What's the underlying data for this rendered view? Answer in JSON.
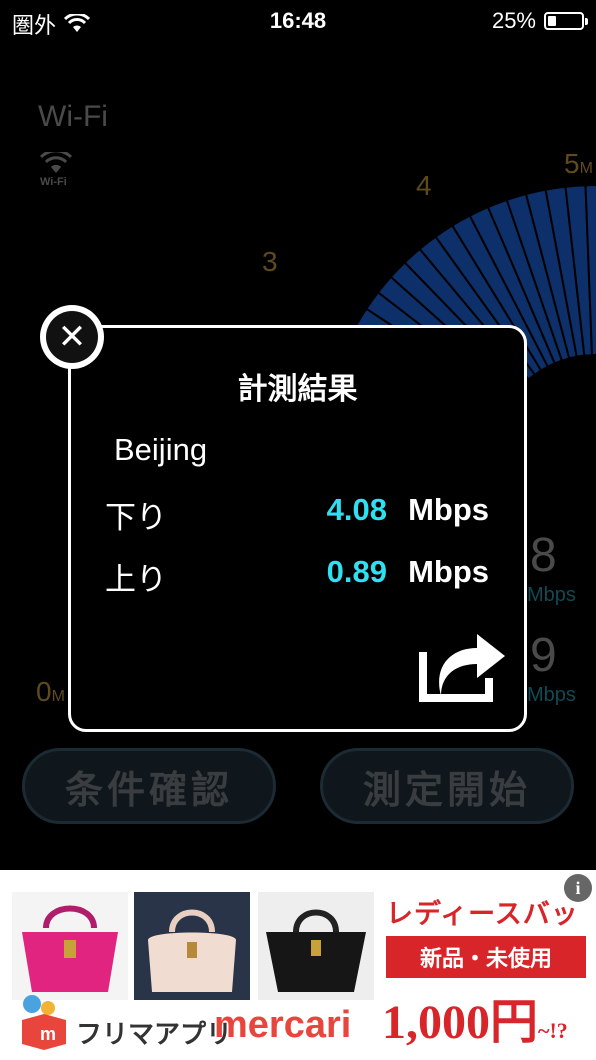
{
  "status_bar": {
    "carrier": "圏外",
    "time": "16:48",
    "battery_percent": "25%",
    "battery_level": 0.25
  },
  "background": {
    "network_type": "Wi-Fi",
    "wifi_icon_label": "Wi-Fi",
    "gauge_ticks": [
      "0",
      "3",
      "4",
      "5"
    ],
    "gauge_tick_unit": "M",
    "download_value_partial": "8",
    "upload_value_partial": "9",
    "unit_partial": "Mbps",
    "buttons": {
      "conditions": "条件確認",
      "start": "測定開始"
    }
  },
  "modal": {
    "title": "計測結果",
    "location": "Beijing",
    "download": {
      "label": "下り",
      "value": "4.08",
      "unit": "Mbps"
    },
    "upload": {
      "label": "上り",
      "value": "0.89",
      "unit": "Mbps"
    },
    "close_icon": "close-icon",
    "share_icon": "share-icon"
  },
  "ad": {
    "tagline": "レディースバッグ",
    "badge": "新品・未使用",
    "price": "1,000円",
    "price_suffix": "~!?",
    "brand_jp": "フリマアプリ",
    "brand_en": "mercari",
    "info_icon": "info-icon",
    "colors": {
      "accent": "#d8252a",
      "brand": "#e8453c"
    }
  },
  "colors": {
    "value_cyan": "#2fe0f0",
    "gauge_blue": "#0d2f6a"
  }
}
